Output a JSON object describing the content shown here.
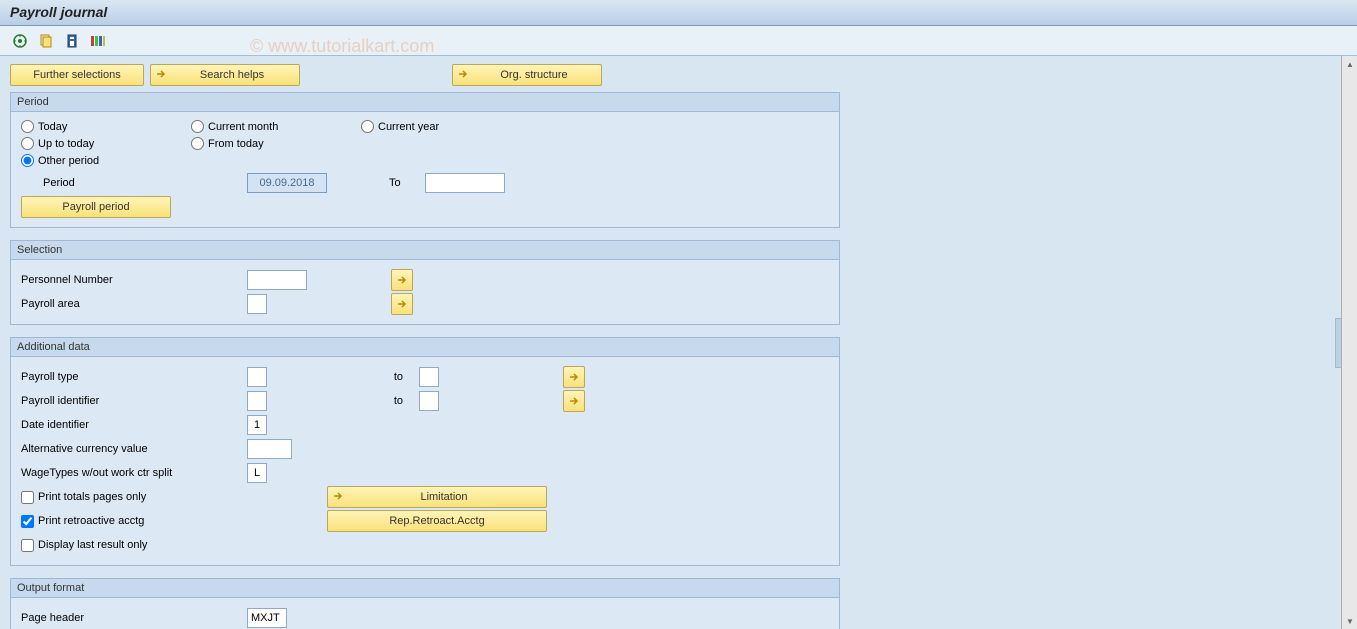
{
  "title": "Payroll journal",
  "watermark": "© www.tutorialkart.com",
  "top_buttons": {
    "further": "Further selections",
    "search": "Search helps",
    "org": "Org. structure"
  },
  "period": {
    "title": "Period",
    "today": "Today",
    "current_month": "Current month",
    "current_year": "Current year",
    "up_to_today": "Up to today",
    "from_today": "From today",
    "other_period": "Other period",
    "period_label": "Period",
    "period_from": "09.09.2018",
    "to_label": "To",
    "period_to": "",
    "payroll_period_btn": "Payroll period"
  },
  "selection": {
    "title": "Selection",
    "personnel_number": "Personnel Number",
    "personnel_number_val": "",
    "payroll_area": "Payroll area",
    "payroll_area_val": ""
  },
  "additional": {
    "title": "Additional data",
    "payroll_type": "Payroll type",
    "payroll_type_from": "",
    "payroll_type_to": "",
    "to_label": "to",
    "payroll_identifier": "Payroll identifier",
    "payroll_identifier_from": "",
    "payroll_identifier_to": "",
    "date_identifier": "Date identifier",
    "date_identifier_val": "1",
    "alt_currency": "Alternative currency value",
    "alt_currency_val": "",
    "wagetypes": "WageTypes w/out work ctr split",
    "wagetypes_val": "L",
    "print_totals": "Print totals pages only",
    "print_retro": "Print retroactive acctg",
    "display_last": "Display last result only",
    "limitation_btn": "Limitation",
    "rep_retro_btn": "Rep.Retroact.Acctg"
  },
  "output": {
    "title": "Output format",
    "page_header": "Page header",
    "page_header_val": "MXJT"
  }
}
